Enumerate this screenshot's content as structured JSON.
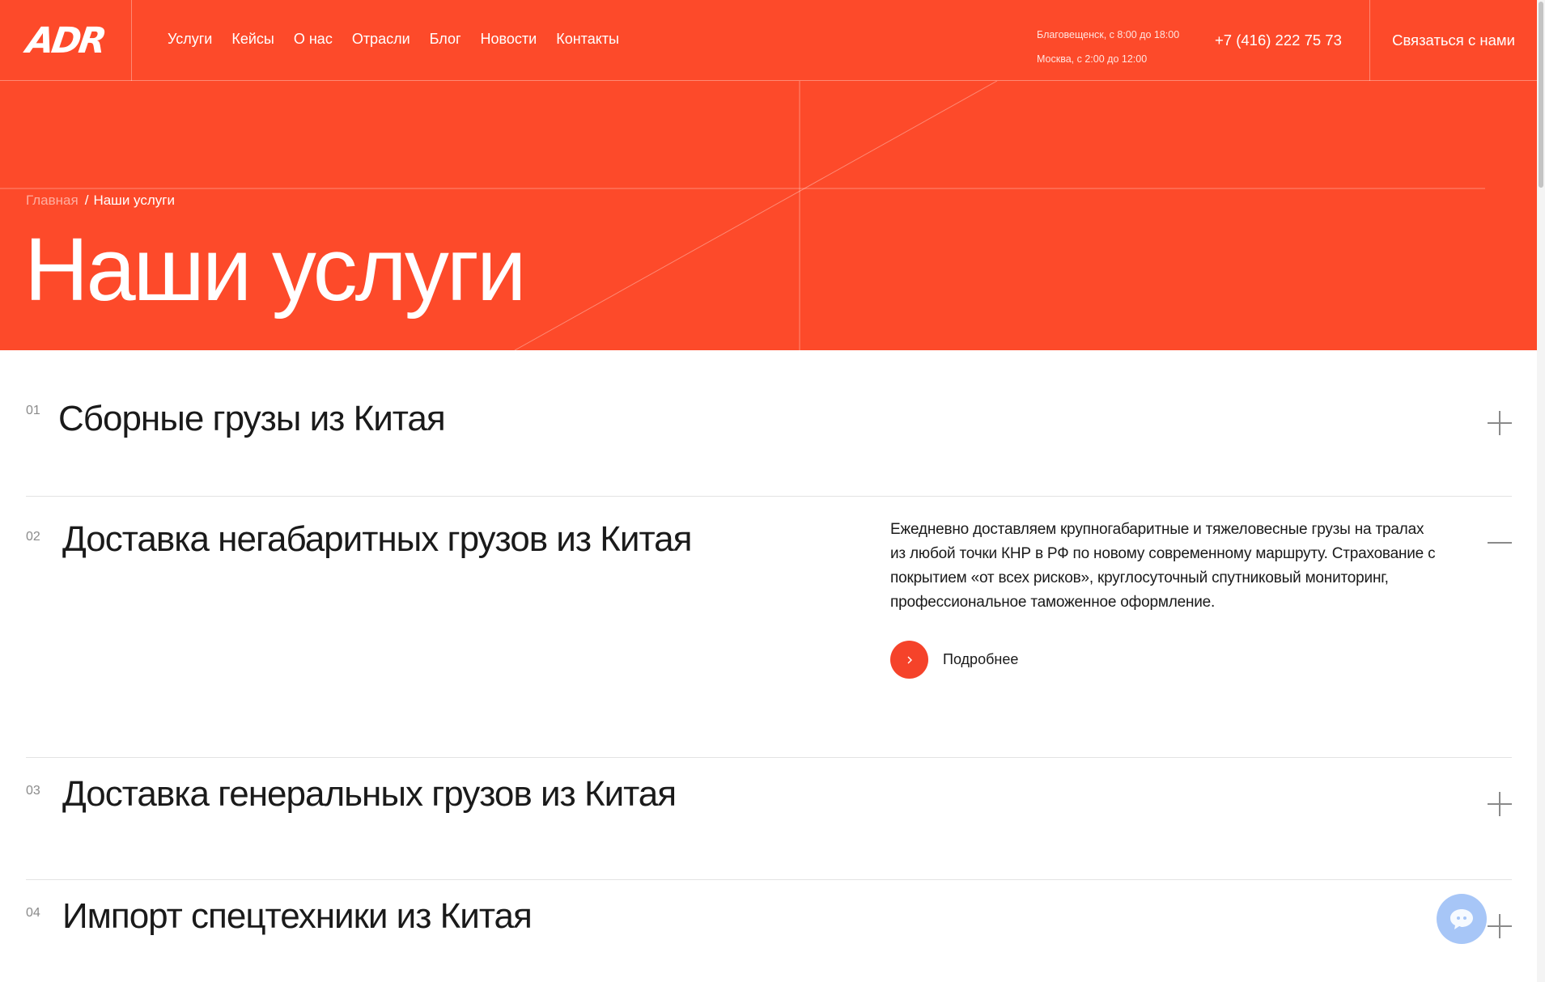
{
  "header": {
    "logo": "ADR",
    "nav": [
      "Услуги",
      "Кейсы",
      "О нас",
      "Отрасли",
      "Блог",
      "Новости",
      "Контакты"
    ],
    "hours": [
      "Благовещенск, с 8:00 до 18:00",
      "Москва, с 2:00 до 12:00"
    ],
    "phone": "+7 (416) 222 75 73",
    "contact_button": "Связаться с нами"
  },
  "hero": {
    "breadcrumb_home": "Главная",
    "breadcrumb_sep": "/",
    "breadcrumb_current": "Наши услуги",
    "title": "Наши услуги"
  },
  "services": [
    {
      "num": "01",
      "title": "Сборные грузы из Китая",
      "expanded": false
    },
    {
      "num": "02",
      "title": "Доставка негабаритных грузов из Китая",
      "expanded": true,
      "description": "Ежедневно доставляем крупногабаритные и тяжеловесные грузы на тралах из любой точки КНР в РФ по новому современному маршруту. Страхование с покрытием «от всех рисков», круглосуточный спутниковый мониторинг, профессиональное таможенное оформление.",
      "more_label": "Подробнее"
    },
    {
      "num": "03",
      "title": "Доставка генеральных грузов из Китая",
      "expanded": false
    },
    {
      "num": "04",
      "title": "Импорт спецтехники из Китая",
      "expanded": false
    }
  ],
  "colors": {
    "brand": "#fd4a2a",
    "chat": "#a7c6f7"
  },
  "icons": {
    "toggle_closed": "plus-icon",
    "toggle_open": "minus-icon",
    "more": "chevron-right-icon",
    "chat": "chat-bubble-icon"
  }
}
